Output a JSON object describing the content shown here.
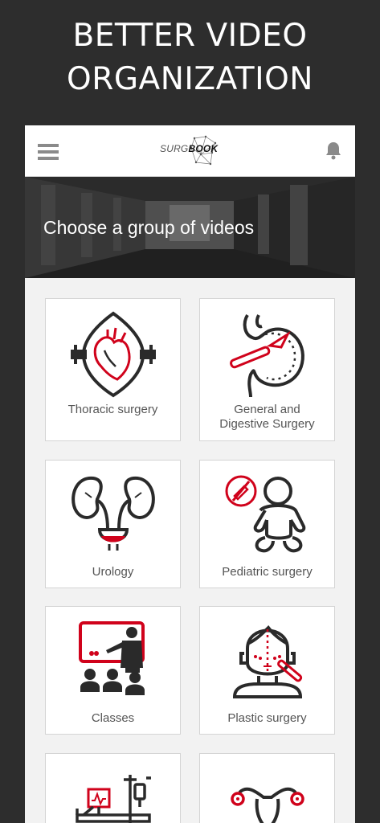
{
  "promo": {
    "line1": "BETTER VIDEO",
    "line2": "ORGANIZATION"
  },
  "header": {
    "logo_light": "SURG",
    "logo_bold": "BOOK",
    "menu_icon": "hamburger-menu-icon",
    "notification_icon": "bell-icon"
  },
  "hero": {
    "title": "Choose a group of videos"
  },
  "colors": {
    "accent": "#d0021b",
    "icon_dark": "#2a2a2a",
    "label": "#555555"
  },
  "groups": [
    {
      "label_line1": "Thoracic surgery",
      "label_line2": "",
      "icon": "heart-icon"
    },
    {
      "label_line1": "General and",
      "label_line2": "Digestive Surgery",
      "icon": "stomach-scalpel-icon"
    },
    {
      "label_line1": "Urology",
      "label_line2": "",
      "icon": "kidneys-icon"
    },
    {
      "label_line1": "Pediatric surgery",
      "label_line2": "",
      "icon": "baby-icon"
    },
    {
      "label_line1": "Classes",
      "label_line2": "",
      "icon": "classroom-icon"
    },
    {
      "label_line1": "Plastic surgery",
      "label_line2": "",
      "icon": "face-incision-icon"
    },
    {
      "label_line1": "",
      "label_line2": "",
      "icon": "hospital-bed-monitor-icon"
    },
    {
      "label_line1": "",
      "label_line2": "",
      "icon": "uterus-icon"
    }
  ]
}
